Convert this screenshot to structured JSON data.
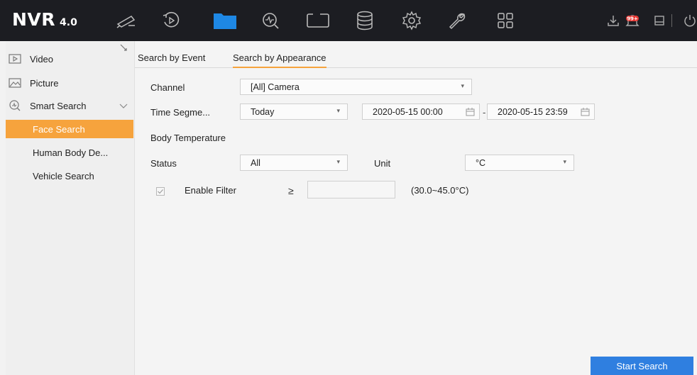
{
  "app": {
    "logo_main": "NVR",
    "logo_version": "4.0"
  },
  "topbar": {
    "icons": [
      "live-view-icon",
      "playback-icon",
      "file-management-icon",
      "smart-analysis-icon",
      "window-icon",
      "storage-icon",
      "settings-icon",
      "maintenance-icon",
      "apps-grid-icon",
      "download-icon",
      "notification-icon",
      "alarm-icon",
      "power-icon"
    ],
    "notification_badge": "99+",
    "active_icon": "file-management-icon",
    "active_color": "#1e88e5",
    "badge_color": "#e53935"
  },
  "sidebar": {
    "items": [
      {
        "label": "Video",
        "icon": "video-icon"
      },
      {
        "label": "Picture",
        "icon": "picture-icon"
      },
      {
        "label": "Smart Search",
        "icon": "smart-search-icon"
      }
    ],
    "sub_items": [
      {
        "label": "Face Search",
        "active": true
      },
      {
        "label": "Human Body De..."
      },
      {
        "label": "Vehicle Search"
      }
    ],
    "active_color": "#f6a33d"
  },
  "tabs": [
    {
      "label": "Search by Event"
    },
    {
      "label": "Search by Appearance",
      "active": true
    }
  ],
  "form": {
    "channel_label": "Channel",
    "channel_value": "[All] Camera",
    "time_label": "Time Segme...",
    "time_value": "Today",
    "start_time": "2020-05-15 00:00",
    "time_separator": "-",
    "end_time": "2020-05-15 23:59",
    "section_title": "Body Temperature",
    "status_label": "Status",
    "status_value": "All",
    "unit_label": "Unit",
    "unit_value": "°C",
    "enable_filter_label": "Enable Filter",
    "enable_filter_checked": true,
    "comparison_symbol": "≥",
    "temperature_value": "",
    "range_hint": "(30.0~45.0°C)"
  },
  "actions": {
    "start_search": "Start Search",
    "button_color": "#2f7fe0"
  }
}
